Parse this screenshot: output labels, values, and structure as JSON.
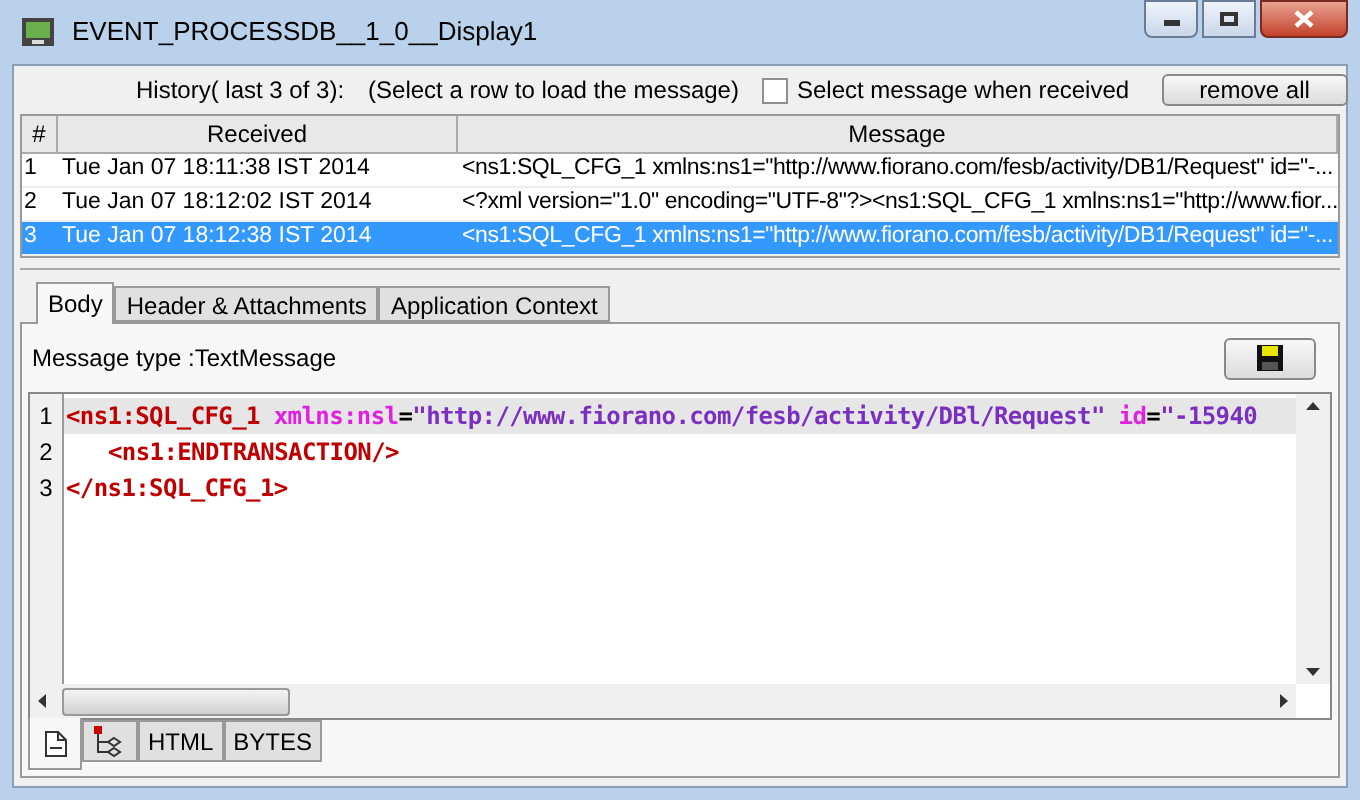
{
  "window": {
    "title": "EVENT_PROCESSDB__1_0__Display1"
  },
  "history": {
    "label": "History( last 3 of 3):",
    "hint": "(Select a row to load the message)",
    "select_when_received": {
      "label": "Select message when received",
      "checked": false
    },
    "remove_button": "remove all"
  },
  "table": {
    "columns": [
      "#",
      "Received",
      "Message"
    ],
    "rows": [
      {
        "index": "1",
        "received": "Tue Jan 07 18:11:38 IST 2014",
        "message": "<ns1:SQL_CFG_1 xmlns:ns1=\"http://www.fiorano.com/fesb/activity/DB1/Request\" id=\"-...",
        "selected": false
      },
      {
        "index": "2",
        "received": "Tue Jan 07 18:12:02 IST 2014",
        "message": "<?xml version=\"1.0\" encoding=\"UTF-8\"?><ns1:SQL_CFG_1 xmlns:ns1=\"http://www.fior...",
        "selected": false
      },
      {
        "index": "3",
        "received": "Tue Jan 07 18:12:38 IST 2014",
        "message": "<ns1:SQL_CFG_1 xmlns:ns1=\"http://www.fiorano.com/fesb/activity/DB1/Request\" id=\"-...",
        "selected": true
      }
    ]
  },
  "tabs": [
    {
      "label": "Body",
      "selected": true
    },
    {
      "label": "Header & Attachments",
      "selected": false
    },
    {
      "label": "Application Context",
      "selected": false
    }
  ],
  "message_type": "Message type :TextMessage",
  "editor": {
    "lines": [
      {
        "number": "1",
        "current": true,
        "indent": false,
        "tokens": [
          {
            "kind": "tag",
            "text": "<ns1:SQL_CFG_1"
          },
          {
            "kind": "attr",
            "text": " xmlns:nsl"
          },
          {
            "kind": "plain",
            "text": "="
          },
          {
            "kind": "value",
            "text": "\"http://www.fiorano.com/fesb/activity/DBl/Request\""
          },
          {
            "kind": "attr",
            "text": " id"
          },
          {
            "kind": "plain",
            "text": "="
          },
          {
            "kind": "value",
            "text": "\"-15940"
          }
        ]
      },
      {
        "number": "2",
        "current": false,
        "indent": true,
        "tokens": [
          {
            "kind": "tag",
            "text": "<ns1:ENDTRANSACTION/>"
          }
        ]
      },
      {
        "number": "3",
        "current": false,
        "indent": false,
        "tokens": [
          {
            "kind": "tag",
            "text": "</ns1:SQL_CFG_1>"
          }
        ]
      }
    ]
  },
  "view_tabs": [
    {
      "kind": "document",
      "selected": true
    },
    {
      "kind": "tree",
      "selected": false
    },
    {
      "kind": "text",
      "label": "HTML",
      "selected": false
    },
    {
      "kind": "text",
      "label": "BYTES",
      "selected": false
    }
  ]
}
